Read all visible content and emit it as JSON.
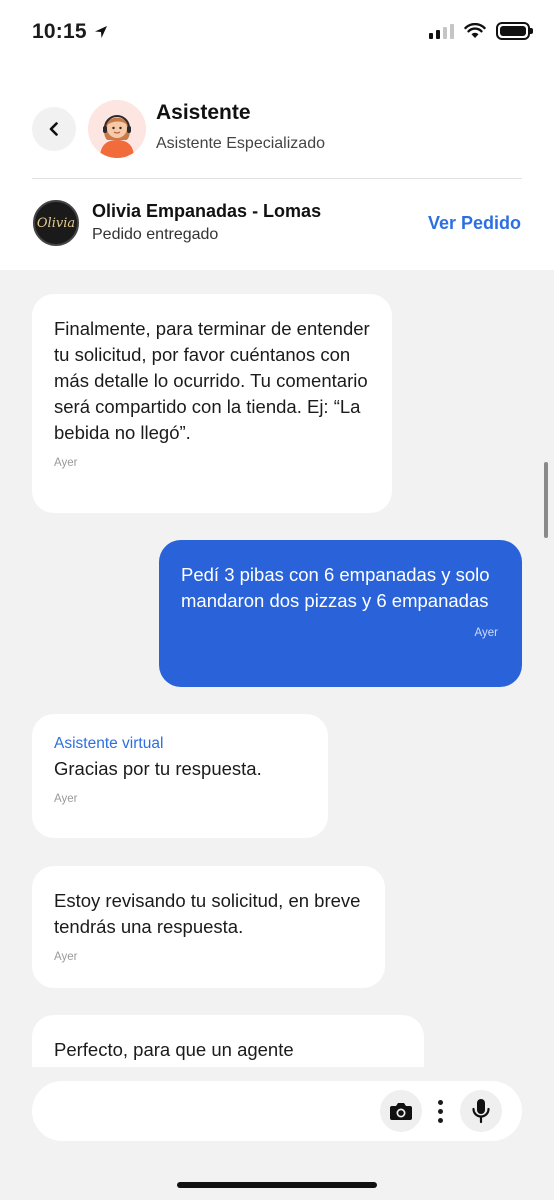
{
  "status_bar": {
    "time": "10:15"
  },
  "header": {
    "assistant_name": "Asistente",
    "assistant_role": "Asistente Especializado",
    "store_name": "Olivia Empanadas - Lomas",
    "order_status": "Pedido entregado",
    "view_order_label": "Ver Pedido",
    "store_logo_text": "Olivia"
  },
  "messages": [
    {
      "direction": "incoming",
      "text": "Finalmente, para terminar de entender tu solicitud, por favor cuéntanos con más detalle lo ocurrido. Tu comentario será compartido con la tienda. Ej: “La bebida no llegó”.",
      "time": "Ayer"
    },
    {
      "direction": "outgoing",
      "text": "Pedí 3 pibas con 6 empanadas y solo mandaron dos pizzas y 6 empanadas",
      "time": "Ayer"
    },
    {
      "direction": "incoming",
      "sender": "Asistente virtual",
      "text": "Gracias por tu respuesta.",
      "time": "Ayer"
    },
    {
      "direction": "incoming",
      "text": "Estoy revisando tu solicitud, en breve tendrás una respuesta.",
      "time": "Ayer"
    },
    {
      "direction": "incoming",
      "text": "Perfecto, para que un agente especializado atienda tu caso",
      "time": ""
    }
  ],
  "input": {
    "placeholder": ""
  },
  "colors": {
    "accent": "#2d6fe0",
    "outgoing_bubble": "#2a63d9",
    "chat_background": "#f2f2f2"
  },
  "icons": [
    "location-arrow-icon",
    "signal-icon",
    "wifi-icon",
    "battery-icon",
    "back-chevron-icon",
    "camera-icon",
    "more-vertical-icon",
    "microphone-icon"
  ]
}
